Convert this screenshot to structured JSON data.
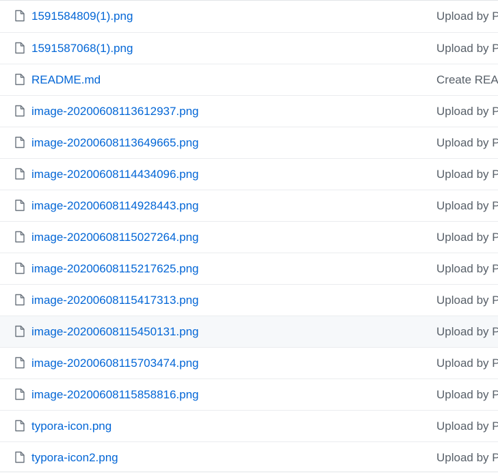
{
  "files": [
    {
      "name": "1591584809(1).png",
      "commit": "Upload by P",
      "icon": "file-icon"
    },
    {
      "name": "1591587068(1).png",
      "commit": "Upload by P",
      "icon": "file-icon"
    },
    {
      "name": "README.md",
      "commit": "Create READ",
      "icon": "file-icon"
    },
    {
      "name": "image-20200608113612937.png",
      "commit": "Upload by P",
      "icon": "file-icon"
    },
    {
      "name": "image-20200608113649665.png",
      "commit": "Upload by P",
      "icon": "file-icon"
    },
    {
      "name": "image-20200608114434096.png",
      "commit": "Upload by P",
      "icon": "file-icon"
    },
    {
      "name": "image-20200608114928443.png",
      "commit": "Upload by P",
      "icon": "file-icon"
    },
    {
      "name": "image-20200608115027264.png",
      "commit": "Upload by P",
      "icon": "file-icon"
    },
    {
      "name": "image-20200608115217625.png",
      "commit": "Upload by P",
      "icon": "file-icon"
    },
    {
      "name": "image-20200608115417313.png",
      "commit": "Upload by P",
      "icon": "file-icon"
    },
    {
      "name": "image-20200608115450131.png",
      "commit": "Upload by P",
      "icon": "file-icon"
    },
    {
      "name": "image-20200608115703474.png",
      "commit": "Upload by P",
      "icon": "file-icon"
    },
    {
      "name": "image-20200608115858816.png",
      "commit": "Upload by P",
      "icon": "file-icon"
    },
    {
      "name": "typora-icon.png",
      "commit": "Upload by P",
      "icon": "file-icon"
    },
    {
      "name": "typora-icon2.png",
      "commit": "Upload by P",
      "icon": "file-icon"
    }
  ],
  "colors": {
    "link": "#0366d6",
    "commit_text": "#586069",
    "icon": "#6a737d",
    "row_border": "#eaecef",
    "hover_row": "#f6f8fa"
  }
}
